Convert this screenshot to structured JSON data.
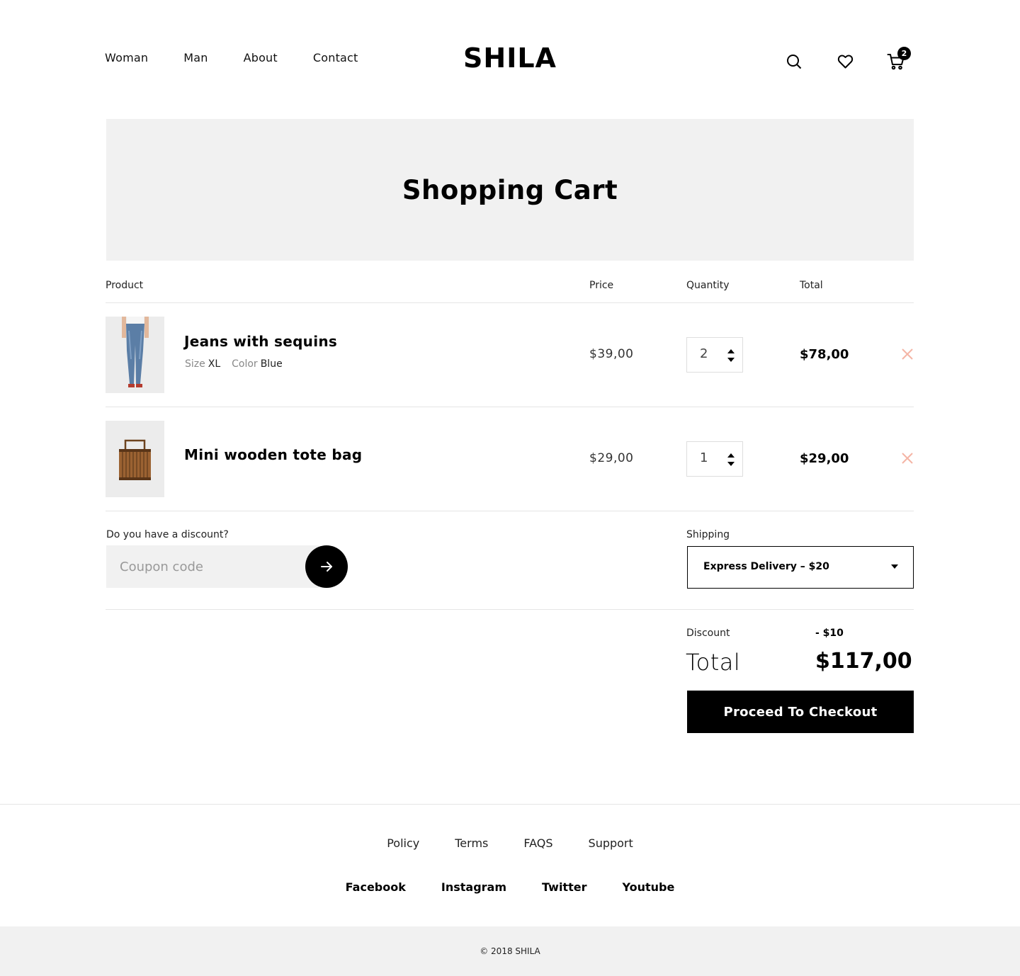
{
  "header": {
    "nav": [
      "Woman",
      "Man",
      "About",
      "Contact"
    ],
    "logo": "SHILA",
    "icons": [
      "search-icon",
      "heart-icon",
      "cart-icon"
    ],
    "cart_count": "2"
  },
  "hero": {
    "title": "Shopping Cart"
  },
  "table": {
    "columns": {
      "product": "Product",
      "price": "Price",
      "quantity": "Quantity",
      "total": "Total"
    },
    "rows": [
      {
        "name": "Jeans with sequins",
        "size_label": "Size",
        "size": "XL",
        "color_label": "Color",
        "color": "Blue",
        "price": "$39,00",
        "quantity": "2",
        "total": "$78,00"
      },
      {
        "name": "Mini wooden tote bag",
        "price": "$29,00",
        "quantity": "1",
        "total": "$29,00"
      }
    ]
  },
  "discount": {
    "label": "Do you have a discount?",
    "placeholder": "Coupon code"
  },
  "shipping": {
    "label": "Shipping",
    "selected": "Express Delivery  –  $20"
  },
  "summary": {
    "discount_label": "Discount",
    "discount_value": "-  $10",
    "total_label": "Total",
    "total_value": "$117,00",
    "checkout_label": "Proceed To Checkout"
  },
  "footer": {
    "links": [
      "Policy",
      "Terms",
      "FAQS",
      "Support"
    ],
    "social": [
      "Facebook",
      "Instagram",
      "Twitter",
      "Youtube"
    ],
    "copyright": "© 2018 SHILA"
  },
  "colors": {
    "accent": "#000000",
    "panel": "#f1f1f1",
    "remove": "#f4b5a6"
  }
}
